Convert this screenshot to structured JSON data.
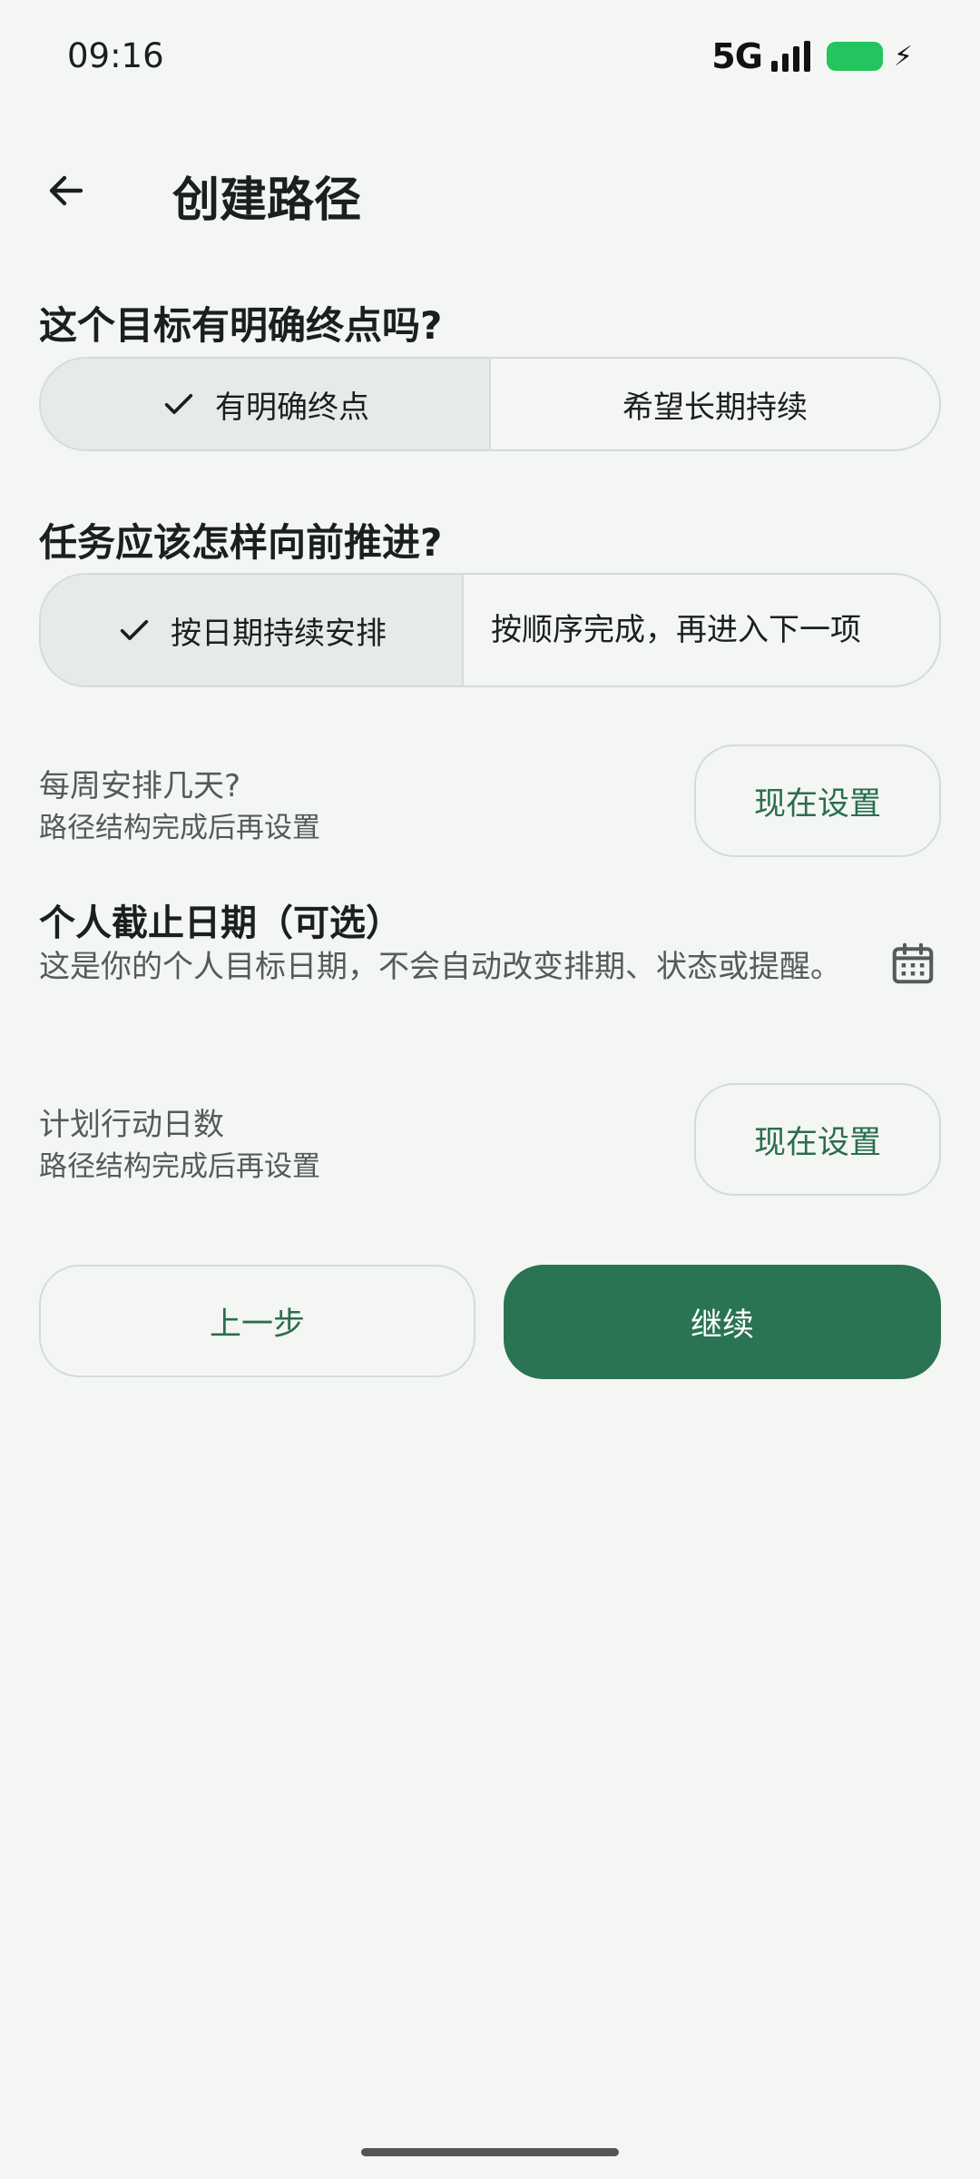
{
  "status_bar": {
    "time": "09:16",
    "network": "5G",
    "battery_color": "#22c55e"
  },
  "header": {
    "title": "创建路径",
    "back_icon": "arrow-left-icon"
  },
  "endpoint": {
    "question": "这个目标有明确终点吗?",
    "options": [
      {
        "label": "有明确终点",
        "selected": true
      },
      {
        "label": "希望长期持续",
        "selected": false
      }
    ]
  },
  "progress_mode": {
    "question": "任务应该怎样向前推进?",
    "options": [
      {
        "label": "按日期持续安排",
        "selected": true
      },
      {
        "label": "按顺序完成，再进入下一项",
        "selected": false
      }
    ]
  },
  "weekly_days": {
    "title": "每周安排几天?",
    "subtitle": "路径结构完成后再设置",
    "button": "现在设置"
  },
  "deadline": {
    "title": "个人截止日期（可选）",
    "description": "这是你的个人目标日期，不会自动改变排期、状态或提醒。",
    "icon": "calendar-icon"
  },
  "action_days": {
    "title": "计划行动日数",
    "subtitle": "路径结构完成后再设置",
    "button": "现在设置"
  },
  "footer": {
    "prev": "上一步",
    "next": "继续"
  },
  "colors": {
    "accent": "#2a7353",
    "accent_text": "#2a6e4e",
    "selected_bg": "#e6ebea",
    "background": "#f4f6f4"
  }
}
